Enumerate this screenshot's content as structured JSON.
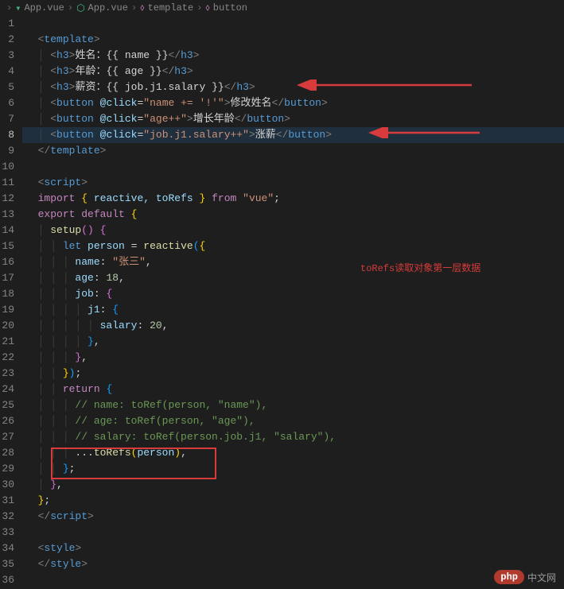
{
  "breadcrumb": {
    "items": [
      "App.vue",
      "App.vue",
      "template",
      "button"
    ]
  },
  "lines": {
    "count": 36,
    "active": 8
  },
  "code": {
    "l2_tag": "template",
    "l3_tag": "h3",
    "l3_label": "姓名：",
    "l3_expr": "name",
    "l4_tag": "h3",
    "l4_label": "年龄：",
    "l4_expr": "age",
    "l5_tag": "h3",
    "l5_label": "薪资：",
    "l5_expr": "job.j1.salary",
    "l6_tag": "button",
    "l6_attr": "@click",
    "l6_val": "name += '!'",
    "l6_text": "修改姓名",
    "l7_tag": "button",
    "l7_attr": "@click",
    "l7_val": "age++",
    "l7_text": "增长年龄",
    "l8_tag": "button",
    "l8_attr": "@click",
    "l8_val": "job.j1.salary++",
    "l8_text": "涨薪",
    "l9_tag": "template",
    "l11_tag": "script",
    "l12_kw": "import",
    "l12_imports": "reactive, toRefs",
    "l12_from": "from",
    "l12_src": "\"vue\"",
    "l13_kw": "export default",
    "l14_fn": "setup",
    "l15_let": "let",
    "l15_var": "person",
    "l15_fn": "reactive",
    "l16_prop": "name",
    "l16_val": "\"张三\"",
    "l17_prop": "age",
    "l17_val": "18",
    "l18_prop": "job",
    "l19_prop": "j1",
    "l20_prop": "salary",
    "l20_val": "20",
    "l24_kw": "return",
    "l25_comment": "// name: toRef(person, \"name\"),",
    "l26_comment": "// age: toRef(person, \"age\"),",
    "l27_comment": "// salary: toRef(person.job.j1, \"salary\"),",
    "l28_spread": "...",
    "l28_fn": "toRefs",
    "l28_arg": "person",
    "l32_tag": "script",
    "l34_tag": "style",
    "l35_tag": "style"
  },
  "annotation": {
    "text": "toRefs读取对象第一层数据"
  },
  "watermark": {
    "pill": "php",
    "text": "中文网"
  }
}
